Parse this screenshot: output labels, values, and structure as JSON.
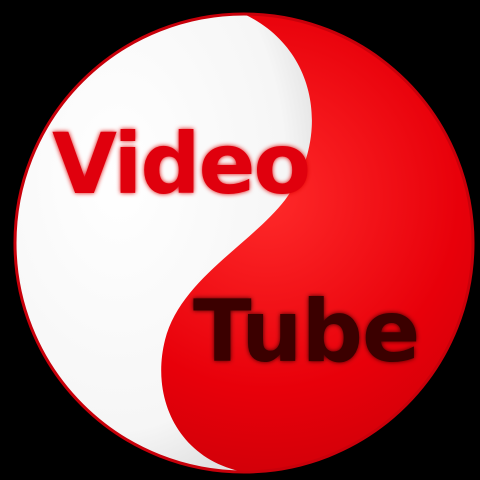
{
  "logo": {
    "word_top": "Video",
    "word_bottom": "Tube",
    "colors": {
      "background": "#000000",
      "red": "#e8000a",
      "white": "#ffffff",
      "video_text": "#e00010",
      "tube_text": "#3a0000",
      "rim": "#c8000a"
    }
  }
}
